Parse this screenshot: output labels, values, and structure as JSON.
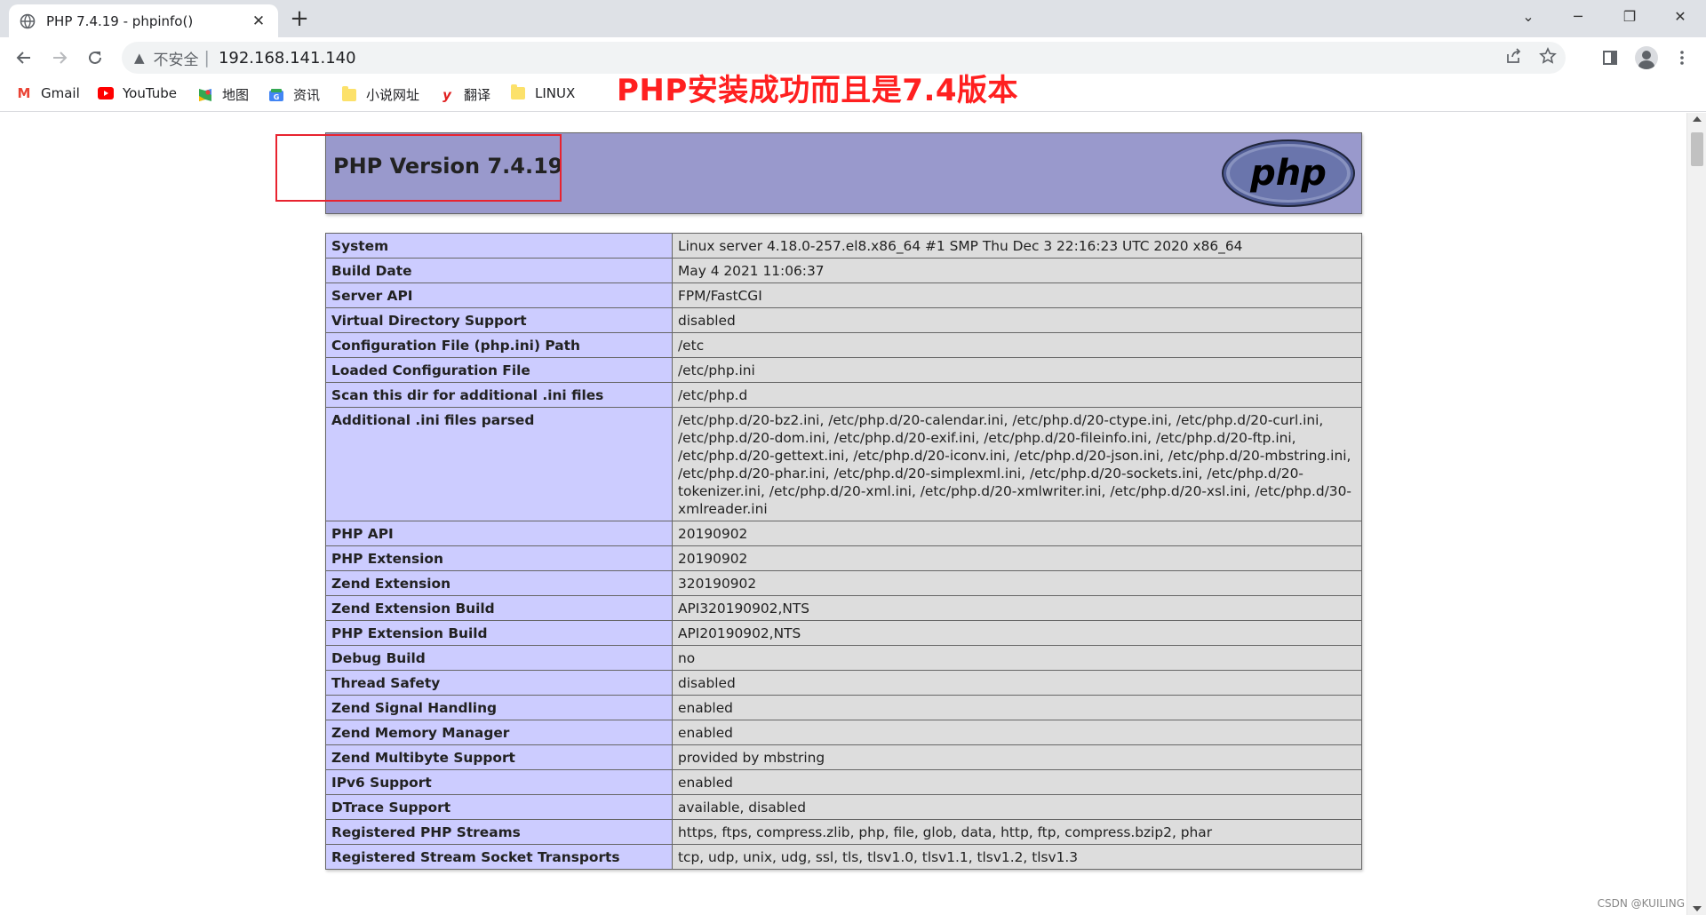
{
  "browser": {
    "tab_title": "PHP 7.4.19 - phpinfo()",
    "tab_close": "✕",
    "new_tab": "+",
    "window_controls": {
      "minimize": "─",
      "maximize": "❐",
      "close": "✕",
      "tablist": "⌄"
    },
    "address": {
      "insecure_label": "不安全",
      "separator": "|",
      "url": "192.168.141.140"
    },
    "bookmarks": [
      {
        "label": "Gmail",
        "icon": "gmail-icon",
        "glyph": "M",
        "color": "#ea4335"
      },
      {
        "label": "YouTube",
        "icon": "youtube-icon",
        "glyph": "▶",
        "color": "#ff0000"
      },
      {
        "label": "地图",
        "icon": "maps-icon",
        "glyph": "◆",
        "color": "#34a853"
      },
      {
        "label": "资讯",
        "icon": "news-icon",
        "glyph": "G",
        "color": "#4285f4"
      },
      {
        "label": "小说网址",
        "icon": "folder-icon",
        "glyph": "",
        "color": "#fce16a"
      },
      {
        "label": "翻译",
        "icon": "youdao-icon",
        "glyph": "y",
        "color": "#e02020"
      },
      {
        "label": "LINUX",
        "icon": "folder-icon",
        "glyph": "",
        "color": "#fce16a"
      }
    ]
  },
  "annotation": "PHP安装成功而且是7.4版本",
  "phpinfo": {
    "version_title": "PHP Version 7.4.19",
    "logo_text": "php",
    "rows": [
      {
        "key": "System",
        "value": "Linux server 4.18.0-257.el8.x86_64 #1 SMP Thu Dec 3 22:16:23 UTC 2020 x86_64"
      },
      {
        "key": "Build Date",
        "value": "May 4 2021 11:06:37"
      },
      {
        "key": "Server API",
        "value": "FPM/FastCGI"
      },
      {
        "key": "Virtual Directory Support",
        "value": "disabled"
      },
      {
        "key": "Configuration File (php.ini) Path",
        "value": "/etc"
      },
      {
        "key": "Loaded Configuration File",
        "value": "/etc/php.ini"
      },
      {
        "key": "Scan this dir for additional .ini files",
        "value": "/etc/php.d"
      },
      {
        "key": "Additional .ini files parsed",
        "value": "/etc/php.d/20-bz2.ini, /etc/php.d/20-calendar.ini, /etc/php.d/20-ctype.ini, /etc/php.d/20-curl.ini, /etc/php.d/20-dom.ini, /etc/php.d/20-exif.ini, /etc/php.d/20-fileinfo.ini, /etc/php.d/20-ftp.ini, /etc/php.d/20-gettext.ini, /etc/php.d/20-iconv.ini, /etc/php.d/20-json.ini, /etc/php.d/20-mbstring.ini, /etc/php.d/20-phar.ini, /etc/php.d/20-simplexml.ini, /etc/php.d/20-sockets.ini, /etc/php.d/20-tokenizer.ini, /etc/php.d/20-xml.ini, /etc/php.d/20-xmlwriter.ini, /etc/php.d/20-xsl.ini, /etc/php.d/30-xmlreader.ini"
      },
      {
        "key": "PHP API",
        "value": "20190902"
      },
      {
        "key": "PHP Extension",
        "value": "20190902"
      },
      {
        "key": "Zend Extension",
        "value": "320190902"
      },
      {
        "key": "Zend Extension Build",
        "value": "API320190902,NTS"
      },
      {
        "key": "PHP Extension Build",
        "value": "API20190902,NTS"
      },
      {
        "key": "Debug Build",
        "value": "no"
      },
      {
        "key": "Thread Safety",
        "value": "disabled"
      },
      {
        "key": "Zend Signal Handling",
        "value": "enabled"
      },
      {
        "key": "Zend Memory Manager",
        "value": "enabled"
      },
      {
        "key": "Zend Multibyte Support",
        "value": "provided by mbstring"
      },
      {
        "key": "IPv6 Support",
        "value": "enabled"
      },
      {
        "key": "DTrace Support",
        "value": "available, disabled"
      },
      {
        "key": "Registered PHP Streams",
        "value": "https, ftps, compress.zlib, php, file, glob, data, http, ftp, compress.bzip2, phar"
      },
      {
        "key": "Registered Stream Socket Transports",
        "value": "tcp, udp, unix, udg, ssl, tls, tlsv1.0, tlsv1.1, tlsv1.2, tlsv1.3"
      }
    ]
  },
  "watermark": "CSDN @KUILING"
}
